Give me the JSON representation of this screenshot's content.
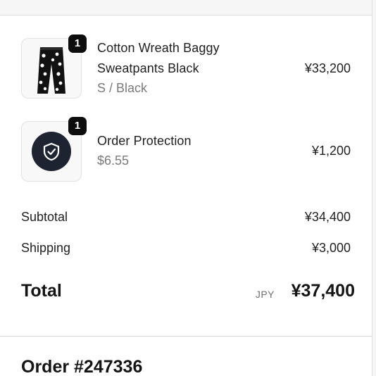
{
  "line_items": [
    {
      "quantity": "1",
      "name_line1": "Cotton Wreath Baggy",
      "name_line2": "Sweatpants Black",
      "variant": "S / Black",
      "price": "¥33,200",
      "thumbnail_icon": "sweatpants-icon"
    },
    {
      "quantity": "1",
      "name_line1": "Order Protection",
      "variant": "$6.55",
      "price": "¥1,200",
      "thumbnail_icon": "shield-check-icon"
    }
  ],
  "summary": {
    "subtotal_label": "Subtotal",
    "subtotal_value": "¥34,400",
    "shipping_label": "Shipping",
    "shipping_value": "¥3,000",
    "total_label": "Total",
    "total_currency": "JPY",
    "total_value": "¥37,400"
  },
  "order": {
    "number": "Order #247336"
  },
  "colors": {
    "badge": "#0d0d0d",
    "shield_circle": "#1d2331",
    "muted_text": "#7a7a7a"
  }
}
